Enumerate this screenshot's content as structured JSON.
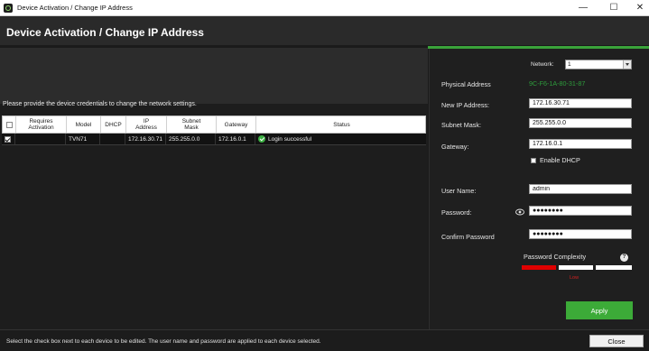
{
  "window": {
    "title": "Device Activation / Change IP Address",
    "minimize": "—",
    "maximize": "☐",
    "close": "✕"
  },
  "header": {
    "title": "Device Activation / Change IP Address"
  },
  "left": {
    "instruction": "Please provide the device credentials to change the network settings.",
    "table": {
      "columns": [
        "",
        "Requires\nActivation",
        "Model",
        "DHCP",
        "IP\nAddress",
        "Subnet\nMask",
        "Gateway",
        "Status"
      ],
      "rows": [
        {
          "checked": true,
          "requires_activation": "",
          "model": "TVN71",
          "dhcp": "",
          "ip": "172.16.30.71",
          "subnet": "255.255.0.0",
          "gateway": "172.16.0.1",
          "status": "Login successful",
          "status_icon": "check-circle-icon"
        }
      ]
    }
  },
  "right": {
    "network_label": "Network:",
    "network_value": "1",
    "physical_address_label": "Physical Address",
    "physical_address_value": "9C-F6-1A-80-31-87",
    "new_ip_label": "New IP Address:",
    "new_ip_value": "172.16.30.71",
    "subnet_label": "Subnet Mask:",
    "subnet_value": "255.255.0.0",
    "gateway_label": "Gateway:",
    "gateway_value": "172.16.0.1",
    "enable_dhcp_label": "Enable DHCP",
    "enable_dhcp_checked": false,
    "username_label": "User Name:",
    "username_value": "admin",
    "password_label": "Password:",
    "password_value": "●●●●●●●●",
    "confirm_label": "Confirm Password",
    "confirm_value": "●●●●●●●●",
    "complexity_label": "Password Complexity",
    "complexity_help": "?",
    "complexity_level_text": "Low",
    "complexity_segments_filled": 1,
    "complexity_segments_total": 3,
    "apply_label": "Apply"
  },
  "footer": {
    "hint": "Select the check box next to each device to be edited. The user name and password are applied to each device selected.",
    "close_label": "Close"
  },
  "colors": {
    "accent_green": "#3cab38",
    "status_green": "#2e9c3c",
    "complexity_low": "#e00000"
  }
}
